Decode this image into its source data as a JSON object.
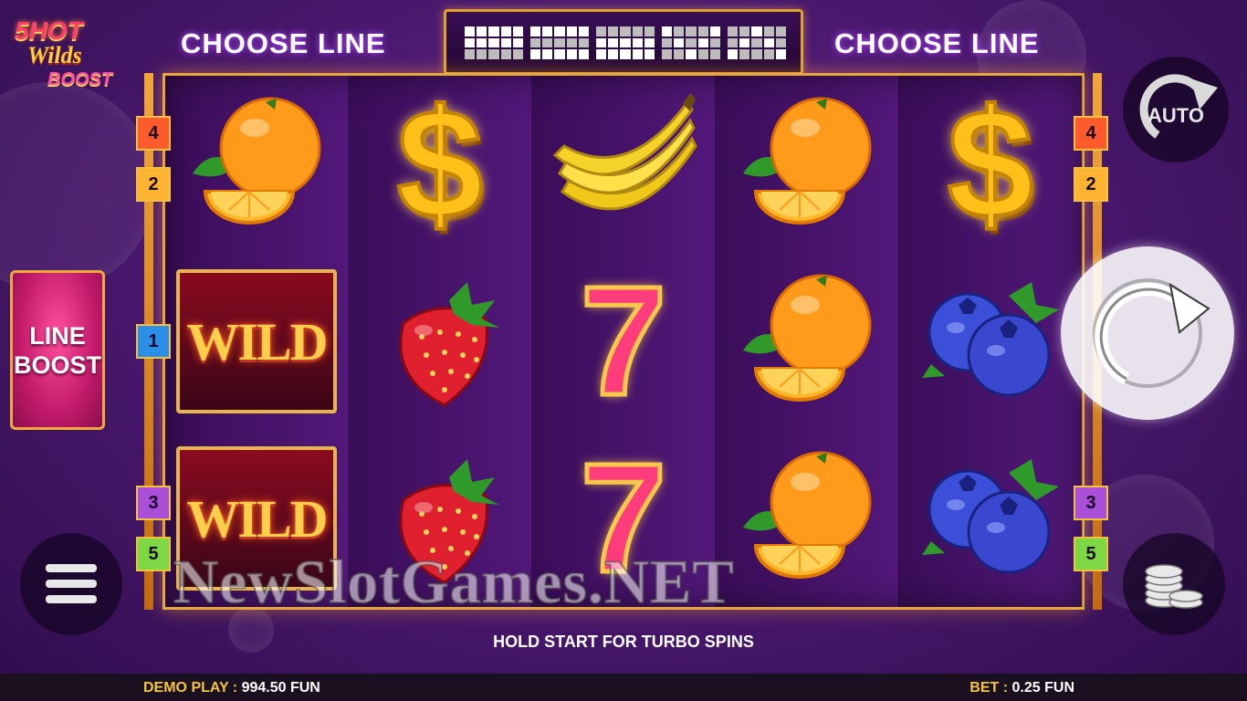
{
  "game": {
    "logo": {
      "line1": "5HOT",
      "line2": "Wilds",
      "line3": "BOOST"
    },
    "choose_line_left": "CHOOSE LINE",
    "choose_line_right": "CHOOSE LINE",
    "line_patterns": [
      [
        1,
        1,
        1,
        1,
        1,
        1,
        1,
        1,
        1,
        1,
        0,
        0,
        0,
        0,
        0
      ],
      [
        1,
        1,
        1,
        1,
        1,
        0,
        0,
        0,
        0,
        0,
        1,
        1,
        1,
        1,
        1
      ],
      [
        0,
        0,
        0,
        0,
        0,
        1,
        1,
        1,
        1,
        1,
        1,
        1,
        1,
        1,
        1
      ],
      [
        1,
        0,
        0,
        0,
        1,
        0,
        1,
        0,
        1,
        0,
        0,
        0,
        1,
        0,
        0
      ],
      [
        0,
        0,
        1,
        0,
        0,
        0,
        1,
        0,
        1,
        0,
        1,
        0,
        0,
        0,
        1
      ]
    ],
    "line_boost": {
      "line1": "LINE",
      "line2": "BOOST"
    },
    "line_numbers_left": [
      "4",
      "2",
      "1",
      "3",
      "5"
    ],
    "line_numbers_right": [
      "4",
      "2",
      "3",
      "5"
    ],
    "reels": [
      [
        "orange",
        "wild",
        "wild"
      ],
      [
        "dollar",
        "strawberry",
        "strawberry"
      ],
      [
        "banana",
        "seven",
        "seven"
      ],
      [
        "orange",
        "orange",
        "orange"
      ],
      [
        "dollar",
        "blueberry",
        "blueberry"
      ]
    ],
    "wild_label": "WILD",
    "seven_label": "7",
    "dollar_label": "$",
    "auto_label": "AUTO",
    "hold_text": "HOLD START FOR TURBO SPINS",
    "watermark": "NewSlotGames.NET",
    "demo_label": "DEMO PLAY :",
    "demo_value": "994.50 FUN",
    "bet_label": "BET :",
    "bet_value": "0.25 FUN",
    "colors": {
      "frame": "#e7a73a",
      "accent_yellow": "#f3c73a"
    },
    "icons": [
      "menu-icon",
      "coins-icon",
      "spin-arrow-icon",
      "auto-arrow-icon"
    ]
  }
}
